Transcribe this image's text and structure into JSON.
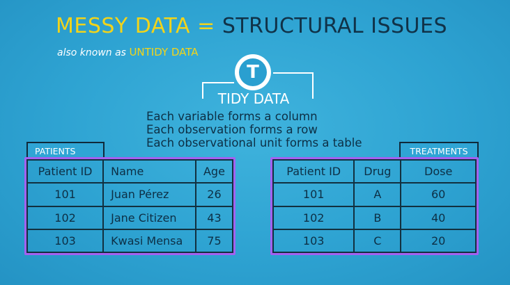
{
  "title": {
    "messy": "MESSY DATA",
    "equals": "=",
    "structural": "STRUCTURAL ISSUES"
  },
  "subtitle": {
    "prefix": "also known as",
    "untidy": "UNTIDY DATA"
  },
  "badge": {
    "letter": "T",
    "icon": "tidy-logo-icon"
  },
  "tidy": {
    "heading": "TIDY DATA",
    "rules": [
      "Each variable forms a column",
      "Each observation forms a row",
      "Each observational unit forms a table"
    ]
  },
  "patients": {
    "label": "PATIENTS",
    "columns": [
      "Patient ID",
      "Name",
      "Age"
    ],
    "rows": [
      [
        "101",
        "Juan Pérez",
        "26"
      ],
      [
        "102",
        "Jane Citizen",
        "43"
      ],
      [
        "103",
        "Kwasi Mensa",
        "75"
      ]
    ]
  },
  "treatments": {
    "label": "TREATMENTS",
    "columns": [
      "Patient ID",
      "Drug",
      "Dose"
    ],
    "rows": [
      [
        "101",
        "A",
        "60"
      ],
      [
        "102",
        "B",
        "40"
      ],
      [
        "103",
        "C",
        "20"
      ]
    ]
  },
  "colors": {
    "background": "#2ea3d2",
    "accent_yellow": "#f2d41a",
    "dark_text": "#103248",
    "highlight_border": "#a361f0"
  }
}
